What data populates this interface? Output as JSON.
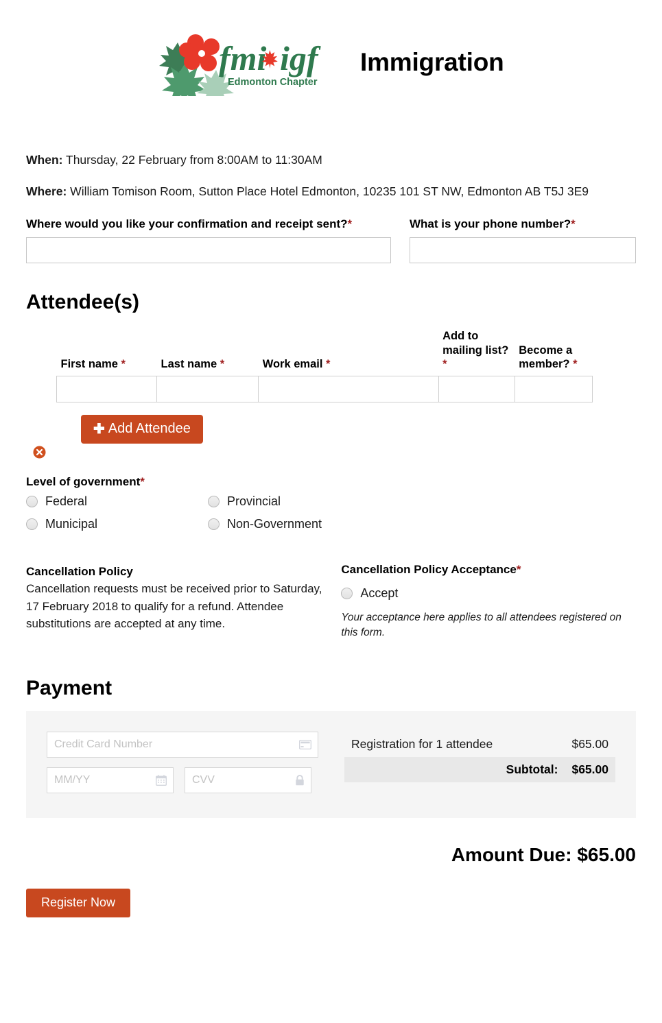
{
  "header": {
    "logo_alt": "fmi igf Edmonton Chapter",
    "logo_text_main": "fmi",
    "logo_text_second": "igf",
    "logo_subtitle": "Edmonton Chapter",
    "title": "Immigration"
  },
  "event": {
    "when_label": "When:",
    "when_value": " Thursday, 22 February from 8:00AM to 11:30AM",
    "where_label": "Where:",
    "where_value": " William Tomison Room, Sutton Place Hotel Edmonton, 10235 101 ST NW, Edmonton AB  T5J 3E9"
  },
  "contact": {
    "email_label": "Where would you like your confirmation and receipt sent?",
    "email_required": "*",
    "email_value": "",
    "phone_label": "What is your phone number?",
    "phone_required": "*",
    "phone_value": ""
  },
  "attendees": {
    "heading": "Attendee(s)",
    "columns": [
      {
        "label": "First name",
        "required": "*"
      },
      {
        "label": "Last name",
        "required": "*"
      },
      {
        "label": "Work email",
        "required": "*"
      },
      {
        "label": "Add to mailing list?",
        "required": "*"
      },
      {
        "label": "Become a member?",
        "required": "*"
      }
    ],
    "rows": [
      {
        "first_name": "",
        "last_name": "",
        "work_email": "",
        "mailing_list": "",
        "become_member": ""
      }
    ],
    "remove_icon": "remove-circle-icon",
    "add_button": "Add Attendee",
    "add_icon": "plus-icon"
  },
  "government": {
    "label": "Level of government",
    "required": "*",
    "options": [
      "Federal",
      "Provincial",
      "Municipal",
      "Non-Government"
    ],
    "selected": ""
  },
  "cancellation": {
    "policy_title": "Cancellation Policy",
    "policy_body": "Cancellation requests must be received prior to Saturday, 17 February 2018 to qualify for a refund. Attendee substitutions are accepted at any time.",
    "acceptance_title": "Cancellation Policy Acceptance",
    "acceptance_required": "*",
    "acceptance_option": "Accept",
    "acceptance_note": "Your acceptance here applies to all attendees registered on this form."
  },
  "payment": {
    "heading": "Payment",
    "card_number_placeholder": "Credit Card Number",
    "card_number_value": "",
    "card_icon": "credit-card-icon",
    "expiry_placeholder": "MM/YY",
    "expiry_value": "",
    "expiry_icon": "calendar-icon",
    "cvv_placeholder": "CVV",
    "cvv_value": "",
    "cvv_icon": "lock-icon",
    "line_item_label": "Registration for 1 attendee",
    "line_item_amount": "$65.00",
    "subtotal_label": "Subtotal:",
    "subtotal_amount": "$65.00",
    "amount_due": "Amount Due: $65.00",
    "register_button": "Register Now"
  },
  "colors": {
    "accent_orange": "#c8481f",
    "required_red": "#9e1b1b",
    "logo_green": "#2e7d4f",
    "logo_red": "#e03a2a",
    "panel_gray": "#f5f5f5",
    "subtotal_gray": "#e8e8e8"
  }
}
